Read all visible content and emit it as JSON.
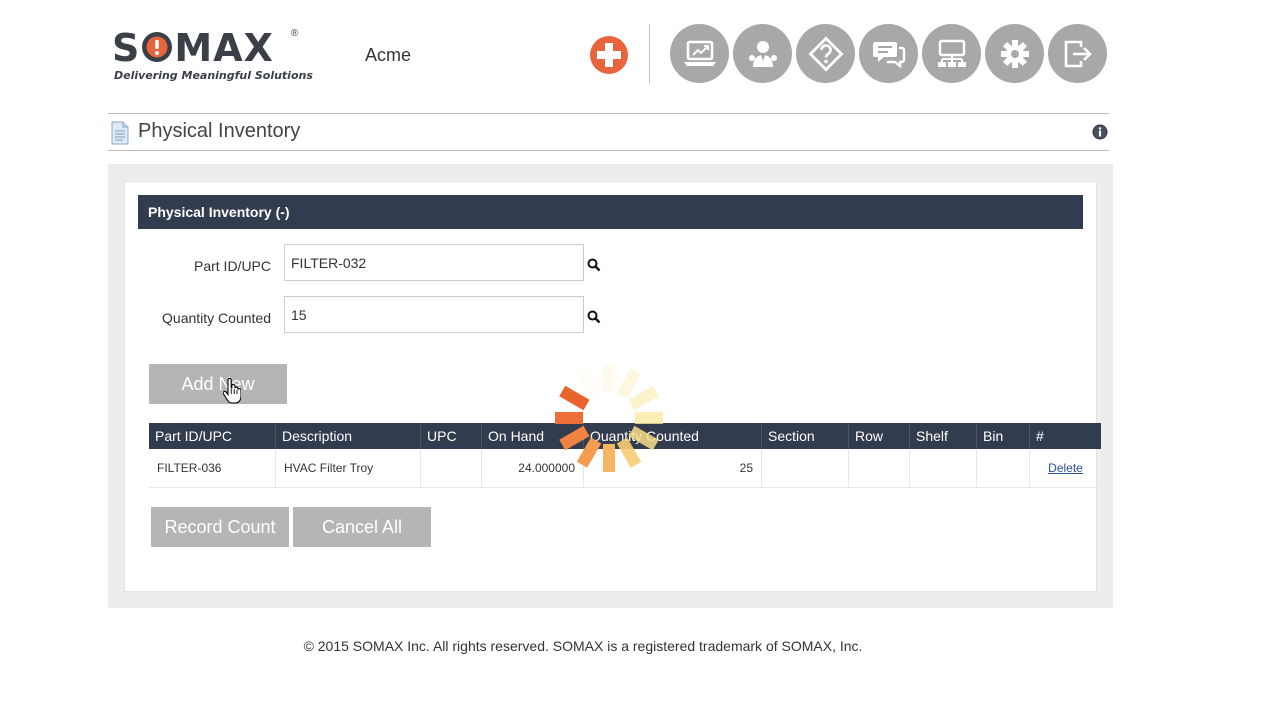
{
  "logo": {
    "word_prefix": "S",
    "word_suffix": "MAX",
    "registered": "®",
    "tagline": "Delivering Meaningful Solutions"
  },
  "header": {
    "company": "Acme",
    "nav_icons": [
      "dashboard-icon",
      "users-icon",
      "help-icon",
      "chat-icon",
      "sitemap-icon",
      "settings-icon",
      "logout-icon"
    ]
  },
  "page": {
    "title": "Physical Inventory"
  },
  "form": {
    "panel_title": "Physical Inventory (-)",
    "part_label": "Part ID/UPC",
    "part_value": "FILTER-032",
    "qty_label": "Quantity Counted",
    "qty_value": "15",
    "add_new": "Add New"
  },
  "table": {
    "columns": [
      "Part ID/UPC",
      "Description",
      "UPC",
      "On Hand",
      "Quantity Counted",
      "Section",
      "Row",
      "Shelf",
      "Bin",
      "#"
    ],
    "rows": [
      {
        "part_id": "FILTER-036",
        "description": "HVAC Filter Troy",
        "upc": "",
        "on_hand": "24.000000",
        "quantity_counted": "25",
        "section": "",
        "row": "",
        "shelf": "",
        "bin": "",
        "action": "Delete"
      }
    ]
  },
  "actions": {
    "record_count": "Record Count",
    "cancel_all": "Cancel All"
  },
  "footer": {
    "text": "© 2015 SOMAX Inc. All rights reserved. SOMAX is a registered trademark of SOMAX, Inc."
  },
  "colors": {
    "header_dark": "#323c4f",
    "accent_orange": "#e8643c",
    "nav_gray": "#a8a8aa",
    "button_gray": "#b5b5b5"
  }
}
